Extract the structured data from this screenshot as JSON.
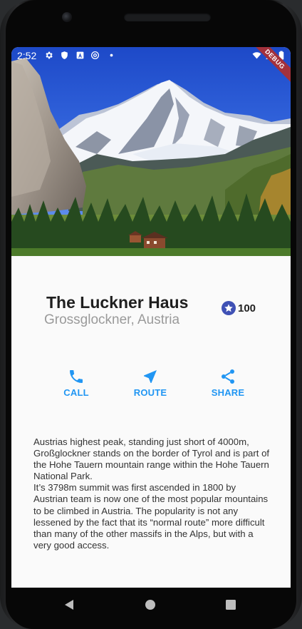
{
  "status_bar": {
    "time": "2:52",
    "left_icons": [
      "settings-icon",
      "shield-icon",
      "a-badge-icon",
      "at-sign-icon",
      "dot-icon"
    ],
    "right_icons": [
      "wifi-icon",
      "signal-icon",
      "battery-icon"
    ],
    "debug_banner": "DEBUG"
  },
  "hero_image": {
    "subject": "mountain-landscape-photo"
  },
  "place": {
    "name": "The Luckner Haus",
    "location": "Grossglockner, Austria",
    "rating_count": "100",
    "rating_icon": "star-icon"
  },
  "actions": [
    {
      "label": "CALL",
      "icon": "phone-icon"
    },
    {
      "label": "ROUTE",
      "icon": "navigation-arrow-icon"
    },
    {
      "label": "SHARE",
      "icon": "share-icon"
    }
  ],
  "description": "Austrias highest peak, standing just short of 4000m, Großglockner stands on the border of Tyrol and is part of the Hohe Tauern mountain range within the Hohe Tauern National Park.\nIt’s 3798m summit was first ascended in 1800 by Austrian team is now one of the most popular mountains to be climbed in Austria. The popularity is not any lessened by the fact that its “normal route” more difficult than many of the other massifs in the Alps, but with a very good access.",
  "nav_bar": {
    "buttons": [
      "back-icon",
      "home-icon",
      "recents-icon"
    ]
  },
  "colors": {
    "accent": "#2196f3",
    "star_badge": "#3f51b5",
    "title": "#1f1f1f",
    "subtitle": "#9a9a9a",
    "debug_ribbon": "#a3313c"
  }
}
